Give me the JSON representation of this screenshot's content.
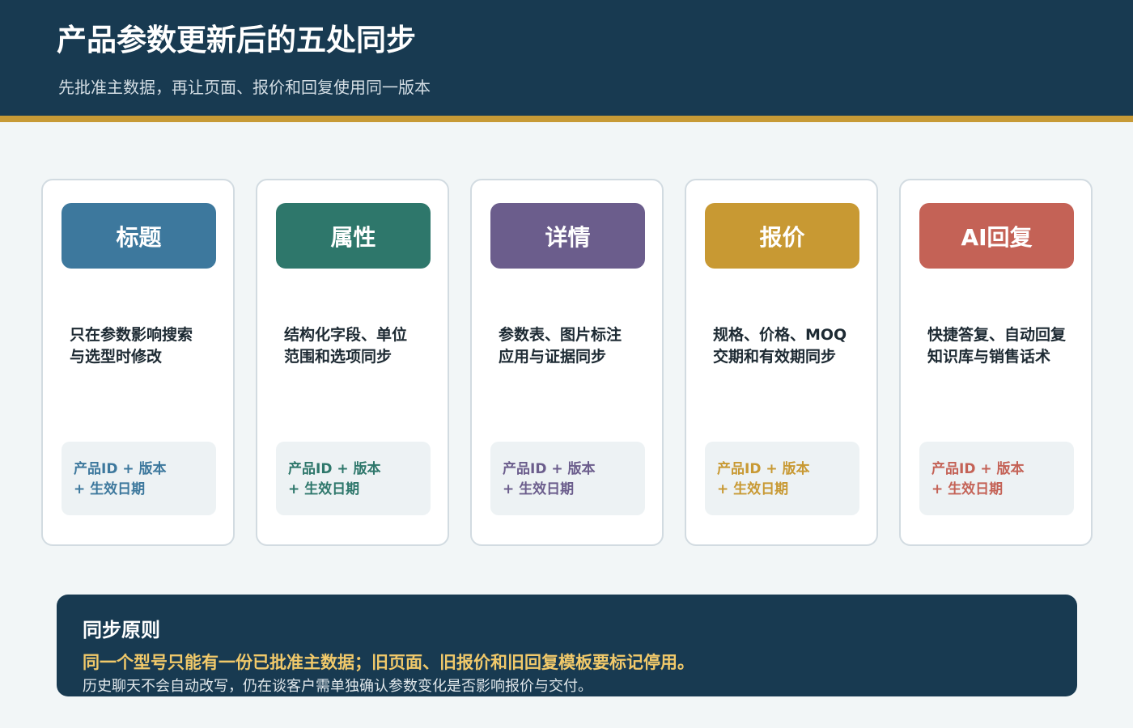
{
  "header": {
    "title": "产品参数更新后的五处同步",
    "subtitle": "先批准主数据，再让页面、报价和回复使用同一版本"
  },
  "cards": [
    {
      "label": "标题",
      "desc": "只在参数影响搜索\n与选型时修改",
      "key": "产品ID + 版本\n+ 生效日期",
      "color": "#3d789d"
    },
    {
      "label": "属性",
      "desc": "结构化字段、单位\n范围和选项同步",
      "key": "产品ID + 版本\n+ 生效日期",
      "color": "#2e776b"
    },
    {
      "label": "详情",
      "desc": "参数表、图片标注\n应用与证据同步",
      "key": "产品ID + 版本\n+ 生效日期",
      "color": "#6b5d8c"
    },
    {
      "label": "报价",
      "desc": "规格、价格、MOQ\n交期和有效期同步",
      "key": "产品ID + 版本\n+ 生效日期",
      "color": "#c89933"
    },
    {
      "label": "AI回复",
      "desc": "快捷答复、自动回复\n知识库与销售话术",
      "key": "产品ID + 版本\n+ 生效日期",
      "color": "#c46256"
    }
  ],
  "principle": {
    "title": "同步原则",
    "highlight": "同一个型号只能有一份已批准主数据；旧页面、旧报价和旧回复模板要标记停用。",
    "note": "历史聊天不会自动改写，仍在谈客户需单独确认参数变化是否影响报价与交付。"
  }
}
